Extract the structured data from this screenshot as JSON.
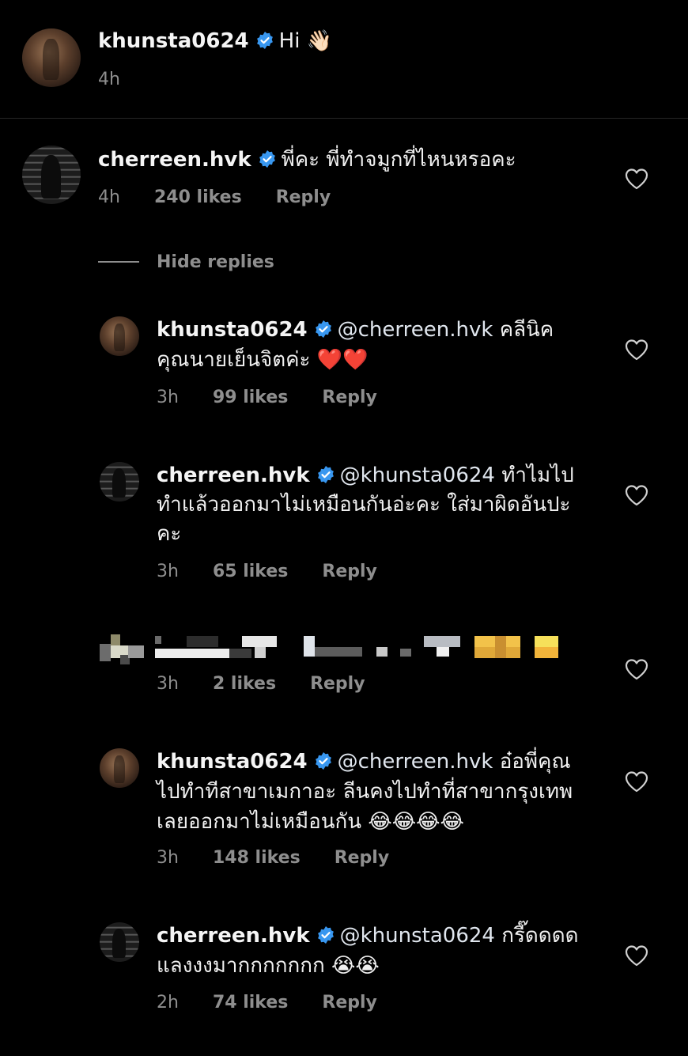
{
  "caption": {
    "username": "khunsta0624",
    "text": "Hi 👋🏻",
    "time": "4h"
  },
  "comment": {
    "username": "cherreen.hvk",
    "text": "พี่คะ พี่ทำจมูกที่ไหนหรอคะ",
    "time": "4h",
    "likes": "240 likes",
    "reply_label": "Reply"
  },
  "hide_replies_label": "Hide replies",
  "replies": [
    {
      "username": "khunsta0624",
      "mention": "@cherreen.hvk",
      "line1": "คลีนิค",
      "line2": "คุณนายเย็นจิตค่ะ ❤️❤️",
      "time": "3h",
      "likes": "99 likes",
      "reply_label": "Reply"
    },
    {
      "username": "cherreen.hvk",
      "mention": "@khunsta0624",
      "line1": "ทำไมไป",
      "line2": "ทำแล้วออกมาไม่เหมือนกันอ่ะคะ ใส่มาผิดอันปะ",
      "line3": "คะ",
      "time": "3h",
      "likes": "65 likes",
      "reply_label": "Reply"
    },
    {
      "username": "",
      "time": "3h",
      "likes": "2 likes",
      "reply_label": "Reply"
    },
    {
      "username": "khunsta0624",
      "mention": "@cherreen.hvk",
      "line1": "อ๋อพี่คุณ",
      "line2": "ไปทำทีสาขาเมกาอะ ลีนคงไปทำที่สาขากรุงเทพ",
      "line3": "เลยออกมาไม่เหมือนกัน 😂😂😂😂",
      "time": "3h",
      "likes": "148 likes",
      "reply_label": "Reply"
    },
    {
      "username": "cherreen.hvk",
      "mention": "@khunsta0624",
      "line1": "กรี๊ดดดด",
      "line2": "แลงงงมากกกกกกก 😭😭",
      "time": "2h",
      "likes": "74 likes",
      "reply_label": "Reply"
    }
  ],
  "icons": {
    "verified": "verified-badge-icon",
    "like": "heart-outline-icon"
  },
  "colors": {
    "background": "#000000",
    "verified_blue": "#3897f0",
    "meta_gray": "#8e8e8e"
  }
}
